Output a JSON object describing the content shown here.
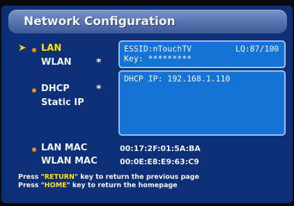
{
  "header": {
    "title": "Network Configuration"
  },
  "menu": {
    "lan": "LAN",
    "wlan": "WLAN",
    "dhcp": "DHCP",
    "static_ip": "Static IP",
    "lan_mac": "LAN MAC",
    "wlan_mac": "WLAN MAC"
  },
  "wlan_panel": {
    "essid": "ESSID:nTouchTV",
    "lq": "LQ:87/100",
    "key": "Key: *********"
  },
  "ip_panel": {
    "dhcp_ip": "DHCP IP: 192.168.1.110"
  },
  "mac": {
    "lan": "00:17:2F:01:5A:BA",
    "wlan": "00:0E:E8:E9:63:C9"
  },
  "footer": {
    "line1_prefix": "Press \"",
    "line1_key": "RETURN",
    "line1_suffix": "\" key to return the previous page",
    "line2_prefix": "Press \"",
    "line2_key": "HOME",
    "line2_suffix": "\" key to return the homepage"
  },
  "colors": {
    "background": "#0d2f78",
    "panel": "#1673d6",
    "active": "#ffe21a",
    "bullet": "#ff8c1f"
  }
}
